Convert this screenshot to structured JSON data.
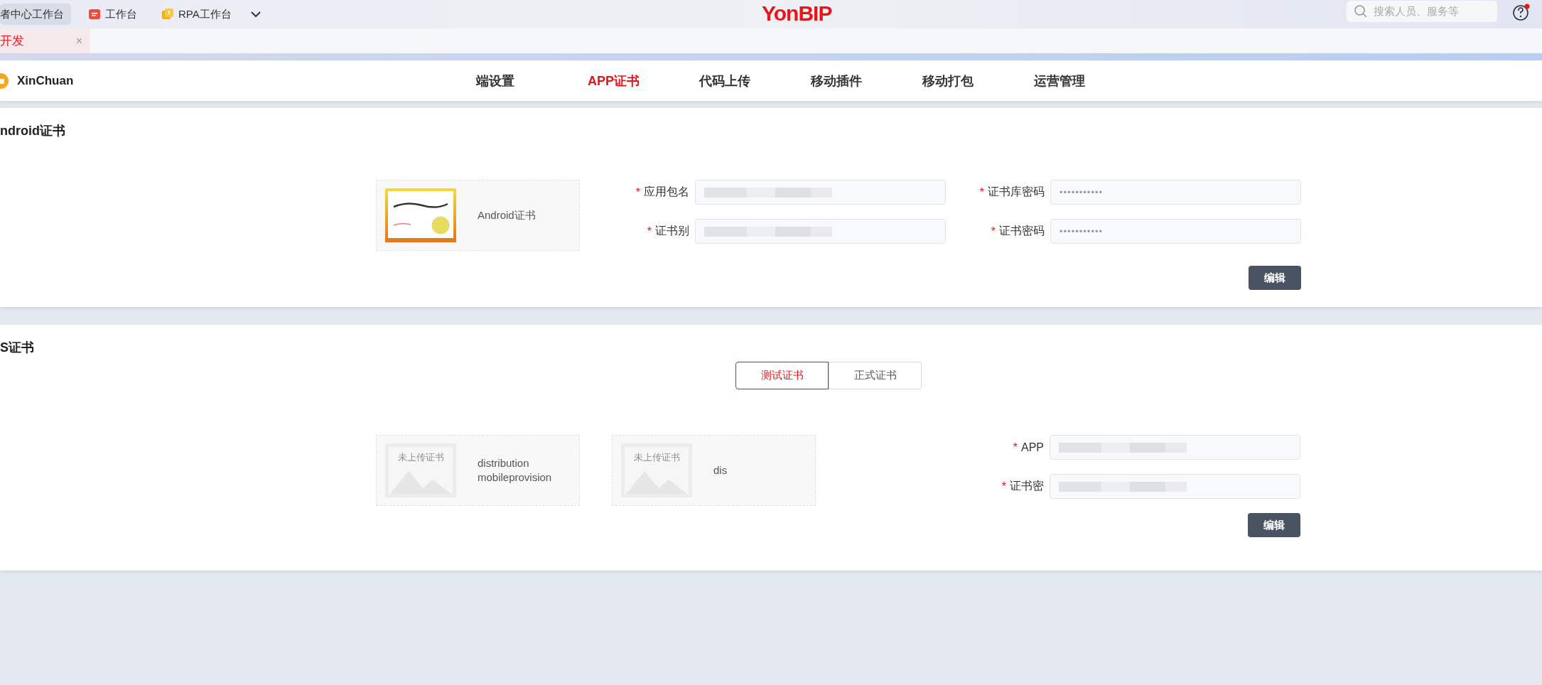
{
  "top_bar": {
    "workbenches": [
      {
        "label": "者中心工作台",
        "selected": true,
        "kind": "plain"
      },
      {
        "label": "工作台",
        "selected": false,
        "kind": "red"
      },
      {
        "label": "RPA工作台",
        "selected": false,
        "kind": "yellow"
      }
    ],
    "logo": "YonBIP",
    "search": {
      "placeholder": "搜索人员、服务等"
    },
    "help": {
      "notification": true
    }
  },
  "open_tabs": [
    {
      "label": "开发",
      "selected": true,
      "close": "×"
    }
  ],
  "app_nav": {
    "app_name": "XinChuan",
    "items": [
      {
        "label": "端设置",
        "selected": false
      },
      {
        "label": "APP证书",
        "selected": true
      },
      {
        "label": "代码上传",
        "selected": false
      },
      {
        "label": "移动插件",
        "selected": false
      },
      {
        "label": "移动打包",
        "selected": false
      },
      {
        "label": "运营管理",
        "selected": false
      }
    ]
  },
  "android": {
    "title": "ndroid证书",
    "certificates": [
      {
        "kind": "uploaded",
        "name": "Android证书"
      }
    ],
    "fields_left": [
      {
        "mark": "*",
        "label": "应用包名",
        "redacted": true
      },
      {
        "mark": "*",
        "label": "证书别",
        "redacted": true
      }
    ],
    "fields_right": [
      {
        "mark": "*",
        "label": "证书库密码",
        "value": "•••••••••••",
        "redacted": false
      },
      {
        "mark": "*",
        "label": "证书密码",
        "value": "•••••••••••",
        "redacted": false
      }
    ],
    "button": "编辑"
  },
  "ios": {
    "title": "S证书",
    "segments": [
      {
        "label": "测试证书",
        "selected": true
      },
      {
        "label": "正式证书",
        "selected": false
      }
    ],
    "certificates": [
      {
        "kind": "empty",
        "placeholder": "未上传证书",
        "name": "distribution mobileprovision"
      },
      {
        "kind": "empty",
        "placeholder": "未上传证书",
        "name": "dis"
      }
    ],
    "fields_right": [
      {
        "mark": "*",
        "label": "APP",
        "redacted": true
      },
      {
        "mark": "*",
        "label": "证书密",
        "redacted": true
      }
    ],
    "button": "编辑"
  }
}
